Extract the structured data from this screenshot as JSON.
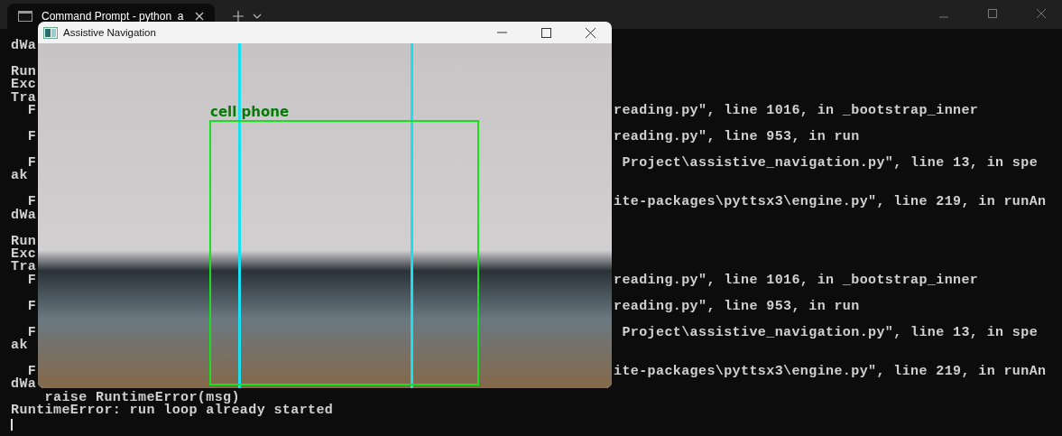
{
  "terminal": {
    "tab": {
      "title": "Command Prompt - python  a",
      "selected": true
    },
    "lines": [
      {
        "kind": "text",
        "left": "dWa"
      },
      {
        "kind": "blank"
      },
      {
        "kind": "text",
        "left": "Run"
      },
      {
        "kind": "text",
        "left": "Exc"
      },
      {
        "kind": "text",
        "left": "Tra"
      },
      {
        "kind": "text",
        "left": "  F",
        "right": "reading.py\", line 1016, in _bootstrap_inner"
      },
      {
        "kind": "blank"
      },
      {
        "kind": "text",
        "left": "  F",
        "right": "reading.py\", line 953, in run"
      },
      {
        "kind": "blank"
      },
      {
        "kind": "text",
        "left": "  F",
        "right": " Project\\assistive_navigation.py\", line 13, in spe"
      },
      {
        "kind": "text",
        "left": "ak"
      },
      {
        "kind": "blank"
      },
      {
        "kind": "text",
        "left": "  F",
        "right": "ite-packages\\pyttsx3\\engine.py\", line 219, in runAn"
      },
      {
        "kind": "text",
        "left": "dWa"
      },
      {
        "kind": "blank"
      },
      {
        "kind": "text",
        "left": "Run"
      },
      {
        "kind": "text",
        "left": "Exc"
      },
      {
        "kind": "text",
        "left": "Tra"
      },
      {
        "kind": "text",
        "left": "  F",
        "right": "reading.py\", line 1016, in _bootstrap_inner"
      },
      {
        "kind": "blank"
      },
      {
        "kind": "text",
        "left": "  F",
        "right": "reading.py\", line 953, in run"
      },
      {
        "kind": "blank"
      },
      {
        "kind": "text",
        "left": "  F",
        "right": " Project\\assistive_navigation.py\", line 13, in spe"
      },
      {
        "kind": "text",
        "left": "ak"
      },
      {
        "kind": "blank"
      },
      {
        "kind": "text",
        "left": "  F",
        "right": "ite-packages\\pyttsx3\\engine.py\", line 219, in runAn"
      },
      {
        "kind": "text",
        "left": "dWa"
      },
      {
        "kind": "text",
        "left": "    raise RuntimeError(msg)"
      },
      {
        "kind": "text",
        "left": "RuntimeError: run loop already started"
      }
    ]
  },
  "camera_window": {
    "title": "Assistive Navigation",
    "detection": {
      "label": "cell phone"
    }
  }
}
